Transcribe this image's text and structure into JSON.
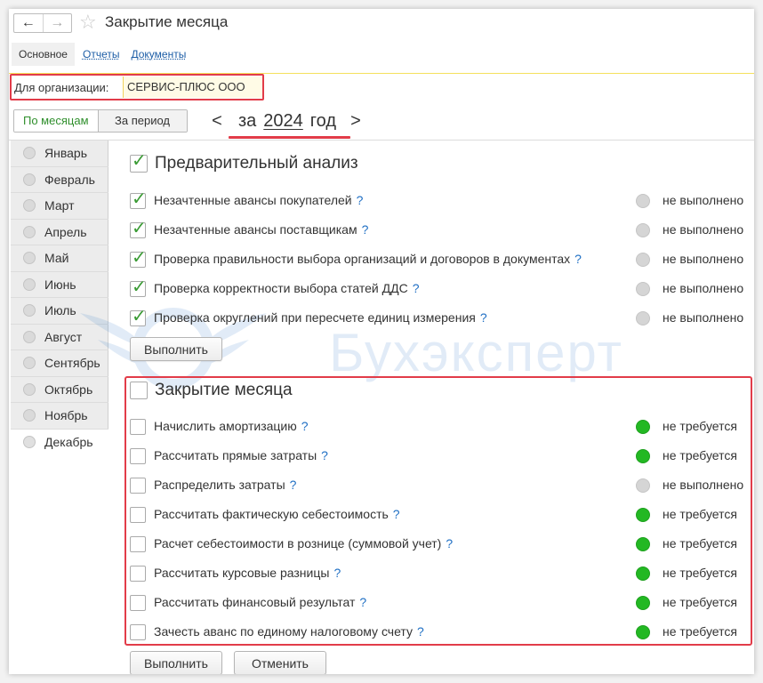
{
  "window": {
    "title": "Закрытие месяца",
    "nav": {
      "back_glyph": "←",
      "forward_glyph": "→",
      "star_glyph": "☆"
    }
  },
  "tabs": [
    {
      "label": "Основное"
    },
    {
      "label": "Отчеты"
    },
    {
      "label": "Документы"
    }
  ],
  "organization": {
    "label": "Для организации:",
    "value": "СЕРВИС-ПЛЮС ООО"
  },
  "period": {
    "mode_monthly": "По месяцам",
    "mode_range": "За период",
    "prefix": "за",
    "year": "2024",
    "suffix": "год",
    "prev_glyph": "<",
    "next_glyph": ">"
  },
  "months": [
    "Январь",
    "Февраль",
    "Март",
    "Апрель",
    "Май",
    "Июнь",
    "Июль",
    "Август",
    "Сентябрь",
    "Октябрь",
    "Ноябрь",
    "Декабрь"
  ],
  "selected_month": "Декабрь",
  "preliminary": {
    "title": "Предварительный анализ",
    "checked": true,
    "items": [
      {
        "label": "Незачтенные авансы покупателей",
        "help": "?",
        "status": "не выполнено",
        "status_color": "gray",
        "checked": true
      },
      {
        "label": "Незачтенные авансы поставщикам",
        "help": "?",
        "status": "не выполнено",
        "status_color": "gray",
        "checked": true
      },
      {
        "label": "Проверка правильности выбора организаций и договоров в документах",
        "help": "?",
        "status": "не выполнено",
        "status_color": "gray",
        "checked": true
      },
      {
        "label": "Проверка корректности выбора статей ДДС",
        "help": "?",
        "status": "не выполнено",
        "status_color": "gray",
        "checked": true
      },
      {
        "label": "Проверка округлений при пересчете единиц измерения",
        "help": "?",
        "status": "не выполнено",
        "status_color": "gray",
        "checked": true
      }
    ],
    "run_label": "Выполнить"
  },
  "closing": {
    "title": "Закрытие месяца",
    "checked": false,
    "items": [
      {
        "label": "Начислить амортизацию",
        "help": "?",
        "status": "не требуется",
        "status_color": "green",
        "checked": false
      },
      {
        "label": "Рассчитать прямые затраты",
        "help": "?",
        "status": "не требуется",
        "status_color": "green",
        "checked": false
      },
      {
        "label": "Распределить затраты",
        "help": "?",
        "status": "не выполнено",
        "status_color": "gray",
        "checked": false
      },
      {
        "label": "Рассчитать фактическую себестоимость",
        "help": "?",
        "status": "не требуется",
        "status_color": "green",
        "checked": false
      },
      {
        "label": "Расчет себестоимости в рознице (суммовой учет)",
        "help": "?",
        "status": "не требуется",
        "status_color": "green",
        "checked": false
      },
      {
        "label": "Рассчитать курсовые разницы",
        "help": "?",
        "status": "не требуется",
        "status_color": "green",
        "checked": false
      },
      {
        "label": "Рассчитать финансовый результат",
        "help": "?",
        "status": "не требуется",
        "status_color": "green",
        "checked": false
      },
      {
        "label": "Зачесть аванс по единому налоговому счету",
        "help": "?",
        "status": "не требуется",
        "status_color": "green",
        "checked": false
      }
    ],
    "run_label": "Выполнить",
    "cancel_label": "Отменить"
  },
  "watermark": {
    "text": "Бухэксперт"
  },
  "colors": {
    "highlight_red": "#e23c49",
    "status_green": "#23b823",
    "status_gray": "#d5d5d5",
    "check_green": "#3a9b34",
    "link_blue": "#1c5da6",
    "help_blue": "#1f6fc4"
  }
}
